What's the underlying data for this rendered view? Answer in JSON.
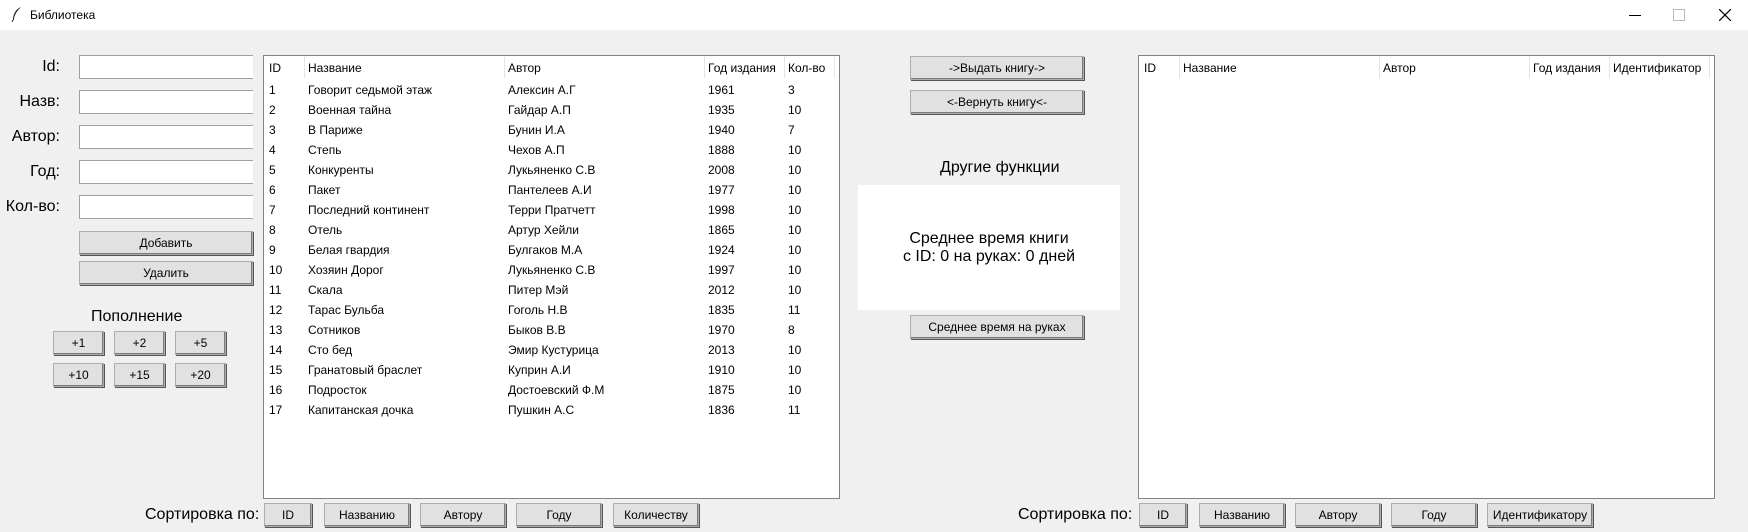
{
  "window": {
    "title": "Библиотека",
    "controls": [
      "—",
      "□",
      "✕"
    ]
  },
  "form": {
    "fields": [
      {
        "label": "Id:",
        "value": ""
      },
      {
        "label": "Назв:",
        "value": ""
      },
      {
        "label": "Автор:",
        "value": ""
      },
      {
        "label": "Год:",
        "value": ""
      },
      {
        "label": "Кол-во:",
        "value": ""
      }
    ],
    "add_label": "Добавить",
    "delete_label": "Удалить"
  },
  "replenish": {
    "title": "Пополнение",
    "buttons": [
      "+1",
      "+2",
      "+5",
      "+10",
      "+15",
      "+20"
    ]
  },
  "left_table": {
    "columns": [
      "ID",
      "Название",
      "Автор",
      "Год издания",
      "Кол-во"
    ],
    "rows": [
      [
        "1",
        "Говорит седьмой этаж",
        "Алексин А.Г",
        "1961",
        "3"
      ],
      [
        "2",
        "Военная тайна",
        "Гайдар А.П",
        "1935",
        "10"
      ],
      [
        "3",
        "В Париже",
        "Бунин И.А",
        "1940",
        "7"
      ],
      [
        "4",
        "Степь",
        "Чехов А.П",
        "1888",
        "10"
      ],
      [
        "5",
        "Конкуренты",
        "Лукьяненко С.В",
        "2008",
        "10"
      ],
      [
        "6",
        "Пакет",
        "Пантелеев А.И",
        "1977",
        "10"
      ],
      [
        "7",
        "Последний континент",
        "Терри Пратчетт",
        "1998",
        "10"
      ],
      [
        "8",
        "Отель",
        "Артур Хейли",
        "1865",
        "10"
      ],
      [
        "9",
        "Белая гвардия",
        "Булгаков М.А",
        "1924",
        "10"
      ],
      [
        "10",
        "Хозяин Дорог",
        "Лукьяненко С.В",
        "1997",
        "10"
      ],
      [
        "11",
        "Скала",
        "Питер Мэй",
        "2012",
        "10"
      ],
      [
        "12",
        "Тарас Бульба",
        "Гоголь Н.В",
        "1835",
        "11"
      ],
      [
        "13",
        "Сотников",
        "Быков В.В",
        "1970",
        "8"
      ],
      [
        "14",
        "Сто бед",
        "Эмир Кустурица",
        "2013",
        "10"
      ],
      [
        "15",
        "Гранатовый браслет",
        "Куприн А.И",
        "1910",
        "10"
      ],
      [
        "16",
        "Подросток",
        "Достоевский Ф.М",
        "1875",
        "10"
      ],
      [
        "17",
        "Капитанская дочка",
        "Пушкин А.С",
        "1836",
        "11"
      ]
    ]
  },
  "middle": {
    "give_label": "->Выдать книгу->",
    "return_label": "<-Вернуть книгу<-",
    "other_title": "Другие функции",
    "info_line1": "Среднее время книги",
    "info_line2": "с ID: 0 на руках: 0 дней",
    "avg_button": "Среднее время на руках"
  },
  "right_table": {
    "columns": [
      "ID",
      "Название",
      "Автор",
      "Год издания",
      "Идентификатор"
    ],
    "rows": []
  },
  "sort_left": {
    "label": "Сортировка по:",
    "buttons": [
      "ID",
      "Названию",
      "Автору",
      "Году",
      "Количеству"
    ]
  },
  "sort_right": {
    "label": "Сортировка по:",
    "buttons": [
      "ID",
      "Названию",
      "Автору",
      "Году",
      "Идентификатору"
    ]
  }
}
